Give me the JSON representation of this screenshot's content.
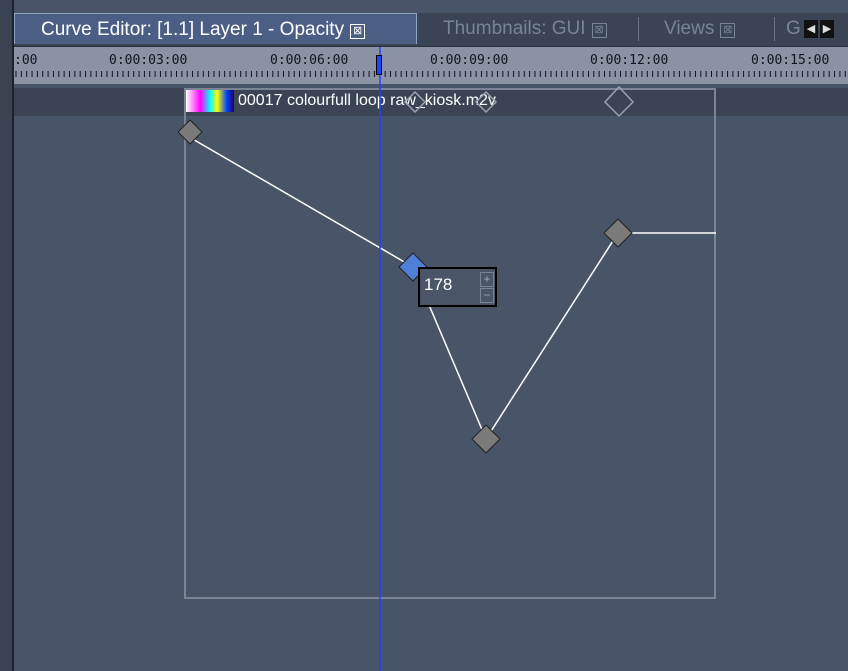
{
  "tabs": [
    {
      "label": "Curve Editor: [1.1] Layer 1 - Opacity",
      "close_glyph": "⊠",
      "active": true
    },
    {
      "label": "Thumbnails: GUI",
      "close_glyph": "⊠",
      "active": false
    },
    {
      "label": "Views",
      "close_glyph": "⊠",
      "active": false
    },
    {
      "label": "G",
      "active": false
    }
  ],
  "tab_scroll": {
    "left_icon": "triangle-left-icon",
    "right_icon": "triangle-right-icon"
  },
  "ruler": {
    "labels": [
      ":00",
      "0:00:03:00",
      "0:00:06:00",
      "0:00:09:00",
      "0:00:12:00",
      "0:00:15:00"
    ]
  },
  "clip": {
    "label": "00017 colourfull loop raw_kiosk.m2v"
  },
  "editor": {
    "value": "178",
    "spin_up": "+",
    "spin_down": "−"
  },
  "colors": {
    "background": "#485467",
    "ruler": "#8a93a3",
    "playhead": "#1c44ff",
    "keyframe": "#7a7a7a",
    "selected_keyframe": "#4f7fd6",
    "curve": "#ffffff",
    "active_tab": "#4b5f85"
  }
}
